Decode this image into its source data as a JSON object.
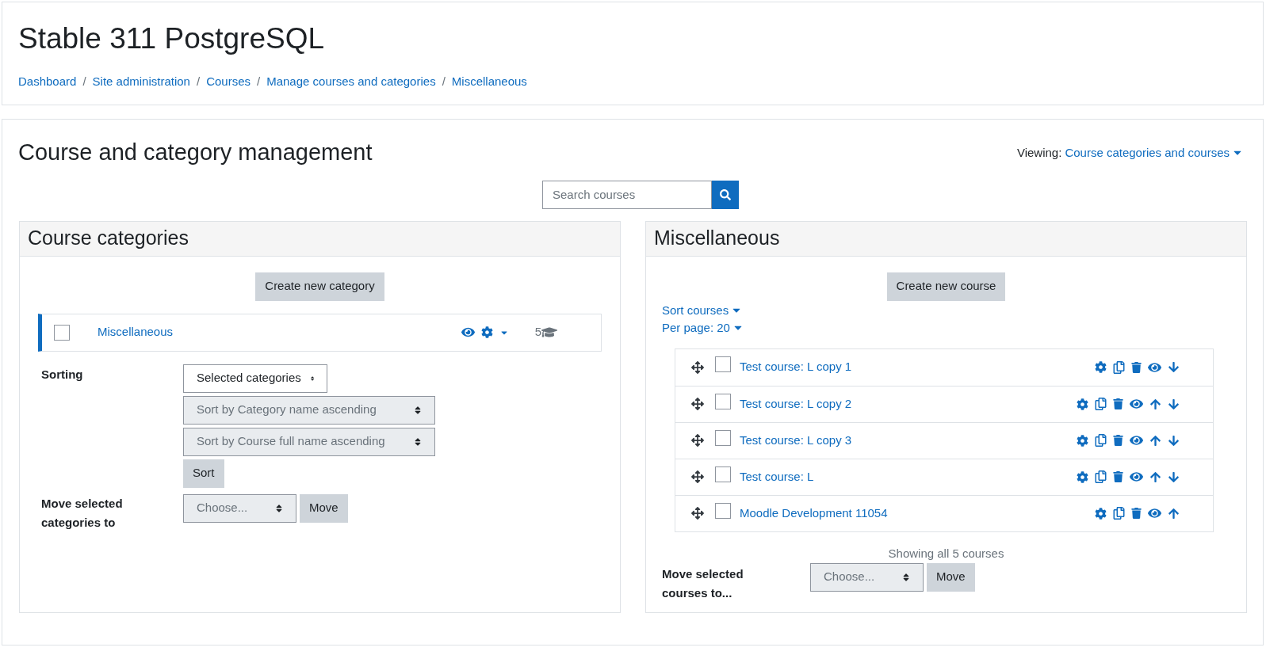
{
  "page_title": "Stable 311 PostgreSQL",
  "breadcrumbs": [
    "Dashboard",
    "Site administration",
    "Courses",
    "Manage courses and categories",
    "Miscellaneous"
  ],
  "breadcrumb_separator": "/",
  "heading": "Course and category management",
  "viewing": {
    "label": "Viewing:",
    "value": "Course categories and courses"
  },
  "search": {
    "placeholder": "Search courses"
  },
  "categories_panel": {
    "title": "Course categories",
    "create_button": "Create new category",
    "categories": [
      {
        "name": "Miscellaneous",
        "selected": true,
        "checked": false,
        "count": "5"
      }
    ],
    "sorting": {
      "label": "Sorting",
      "selects": [
        {
          "value": "Selected categories",
          "disabled": false
        },
        {
          "value": "Sort by Category name ascending",
          "disabled": true
        },
        {
          "value": "Sort by Course full name ascending",
          "disabled": true
        }
      ],
      "button": "Sort"
    },
    "move": {
      "label": "Move selected categories to",
      "select": {
        "value": "Choose...",
        "disabled": true
      },
      "button": "Move"
    }
  },
  "courses_panel": {
    "title": "Miscellaneous",
    "create_button": "Create new course",
    "sort_link": "Sort courses",
    "per_page_link": "Per page: 20",
    "courses": [
      {
        "name": "Test course: L copy 1",
        "checked": false,
        "can_move_up": false,
        "can_move_down": true
      },
      {
        "name": "Test course: L copy 2",
        "checked": false,
        "can_move_up": true,
        "can_move_down": true
      },
      {
        "name": "Test course: L copy 3",
        "checked": false,
        "can_move_up": true,
        "can_move_down": true
      },
      {
        "name": "Test course: L",
        "checked": false,
        "can_move_up": true,
        "can_move_down": true
      },
      {
        "name": "Moodle Development 11054",
        "checked": false,
        "can_move_up": true,
        "can_move_down": false
      }
    ],
    "showing": "Showing all 5 courses",
    "move": {
      "label": "Move selected courses to...",
      "select": {
        "value": "Choose...",
        "disabled": true
      },
      "button": "Move"
    }
  }
}
